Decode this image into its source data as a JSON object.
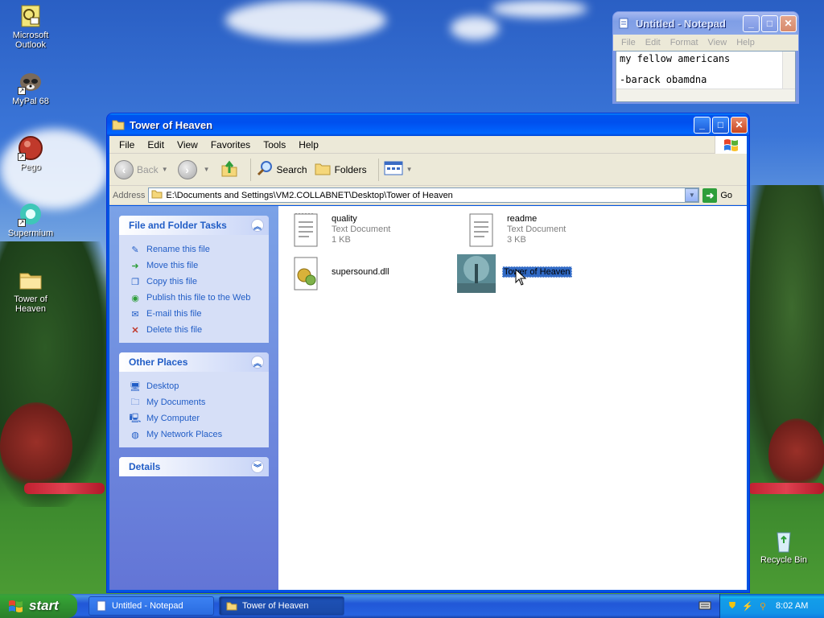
{
  "desktop": {
    "icons": [
      {
        "label": "Microsoft Outlook"
      },
      {
        "label": "MyPal 68"
      },
      {
        "label": "Pego"
      },
      {
        "label": "Supermium"
      },
      {
        "label": "Tower of Heaven"
      },
      {
        "label": "Recycle Bin"
      }
    ]
  },
  "notepad": {
    "title": "Untitled - Notepad",
    "menu": [
      "File",
      "Edit",
      "Format",
      "View",
      "Help"
    ],
    "lines": [
      "my fellow americans",
      "",
      "-barack obamdna"
    ]
  },
  "explorer": {
    "title": "Tower of Heaven",
    "menu": [
      "File",
      "Edit",
      "View",
      "Favorites",
      "Tools",
      "Help"
    ],
    "toolbar": {
      "back": "Back",
      "search": "Search",
      "folders": "Folders"
    },
    "address": {
      "label": "Address",
      "value": "E:\\Documents and Settings\\VM2.COLLABNET\\Desktop\\Tower of Heaven",
      "go": "Go"
    },
    "tasks": {
      "file_folder": {
        "title": "File and Folder Tasks",
        "items": [
          {
            "label": "Rename this file",
            "icon": "rename-icon"
          },
          {
            "label": "Move this file",
            "icon": "move-icon"
          },
          {
            "label": "Copy this file",
            "icon": "copy-icon"
          },
          {
            "label": "Publish this file to the Web",
            "icon": "publish-icon"
          },
          {
            "label": "E-mail this file",
            "icon": "email-icon"
          },
          {
            "label": "Delete this file",
            "icon": "delete-icon"
          }
        ]
      },
      "other_places": {
        "title": "Other Places",
        "items": [
          {
            "label": "Desktop",
            "icon": "desktop-icon"
          },
          {
            "label": "My Documents",
            "icon": "documents-icon"
          },
          {
            "label": "My Computer",
            "icon": "computer-icon"
          },
          {
            "label": "My Network Places",
            "icon": "network-icon"
          }
        ]
      },
      "details": {
        "title": "Details"
      }
    },
    "files": [
      {
        "name": "quality",
        "type": "Text Document",
        "size": "1 KB",
        "icon": "text-document-icon"
      },
      {
        "name": "readme",
        "type": "Text Document",
        "size": "3 KB",
        "icon": "text-document-icon"
      },
      {
        "name": "supersound.dll",
        "type": "",
        "size": "",
        "icon": "dll-icon"
      },
      {
        "name": "Tower of Heaven",
        "type": "",
        "size": "",
        "icon": "game-exe-icon",
        "selected": true
      }
    ]
  },
  "taskbar": {
    "start": "start",
    "buttons": [
      {
        "label": "Untitled - Notepad",
        "active": false
      },
      {
        "label": "Tower of Heaven",
        "active": true
      }
    ],
    "clock": "8:02 AM"
  },
  "colors": {
    "xp_blue": "#0054e3",
    "selection": "#316ac5",
    "task_link": "#215dc6"
  }
}
